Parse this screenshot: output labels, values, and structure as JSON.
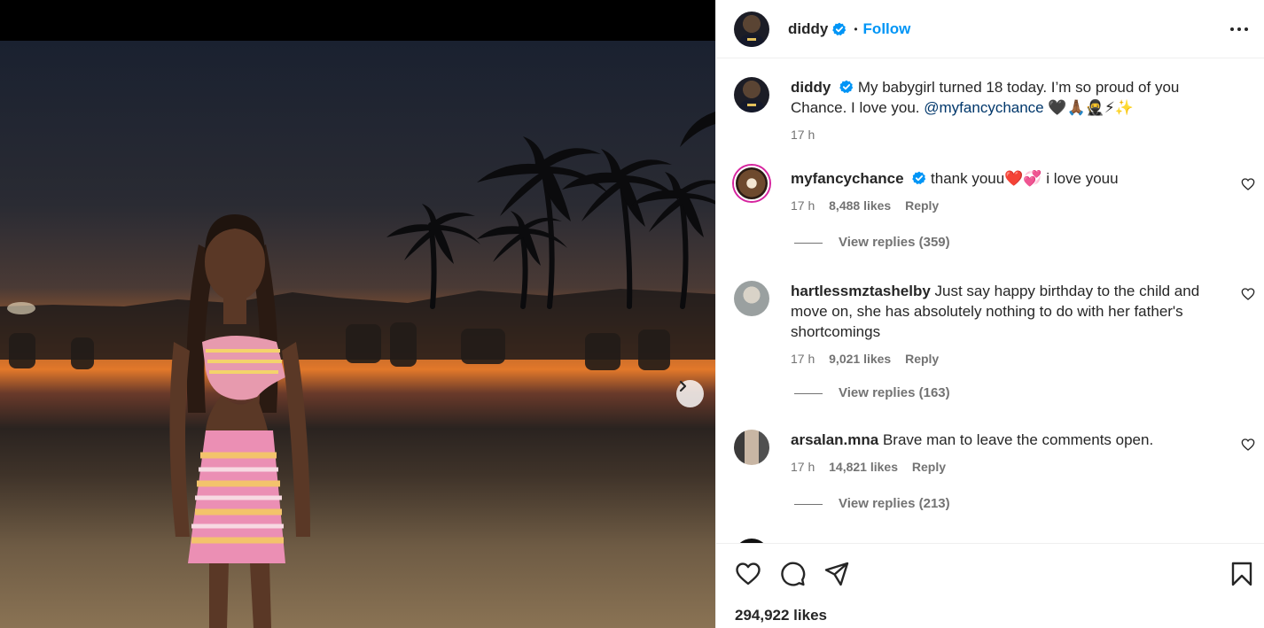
{
  "post": {
    "username": "diddy",
    "follow_label": "Follow",
    "dot": "•",
    "caption": "My babygirl turned 18 today. I’m so proud of you Chance. I love you.",
    "caption_mention": "@myfancychance",
    "caption_emojis": "🖤🙏🏾🥷⚡✨",
    "time": "17 h",
    "total_likes": "294,922 likes"
  },
  "comments": [
    {
      "username": "myfancychance",
      "text_before": "thank youu",
      "emojis": "❤️💞",
      "text_after": " i love youu",
      "time": "17 h",
      "likes": "8,488 likes",
      "reply": "Reply",
      "view_replies": "View replies (359)"
    },
    {
      "username": "hartlessmztashelby",
      "text": "Just say happy birthday to the child and move on, she has absolutely nothing to do with her father's shortcomings",
      "time": "17 h",
      "likes": "9,021 likes",
      "reply": "Reply",
      "view_replies": "View replies (163)"
    },
    {
      "username": "arsalan.mna",
      "text": "Brave man to leave the comments open.",
      "time": "17 h",
      "likes": "14,821 likes",
      "reply": "Reply",
      "view_replies": "View replies (213)"
    }
  ],
  "icons": {
    "verified": "verified-badge-icon",
    "more": "more-options-icon",
    "like": "heart-icon",
    "comment": "comment-icon",
    "share": "share-icon",
    "save": "bookmark-icon",
    "next": "chevron-right-icon"
  },
  "colors": {
    "accent": "#0095f6",
    "verified": "#0095f6",
    "text": "#262626",
    "muted": "#737373"
  }
}
